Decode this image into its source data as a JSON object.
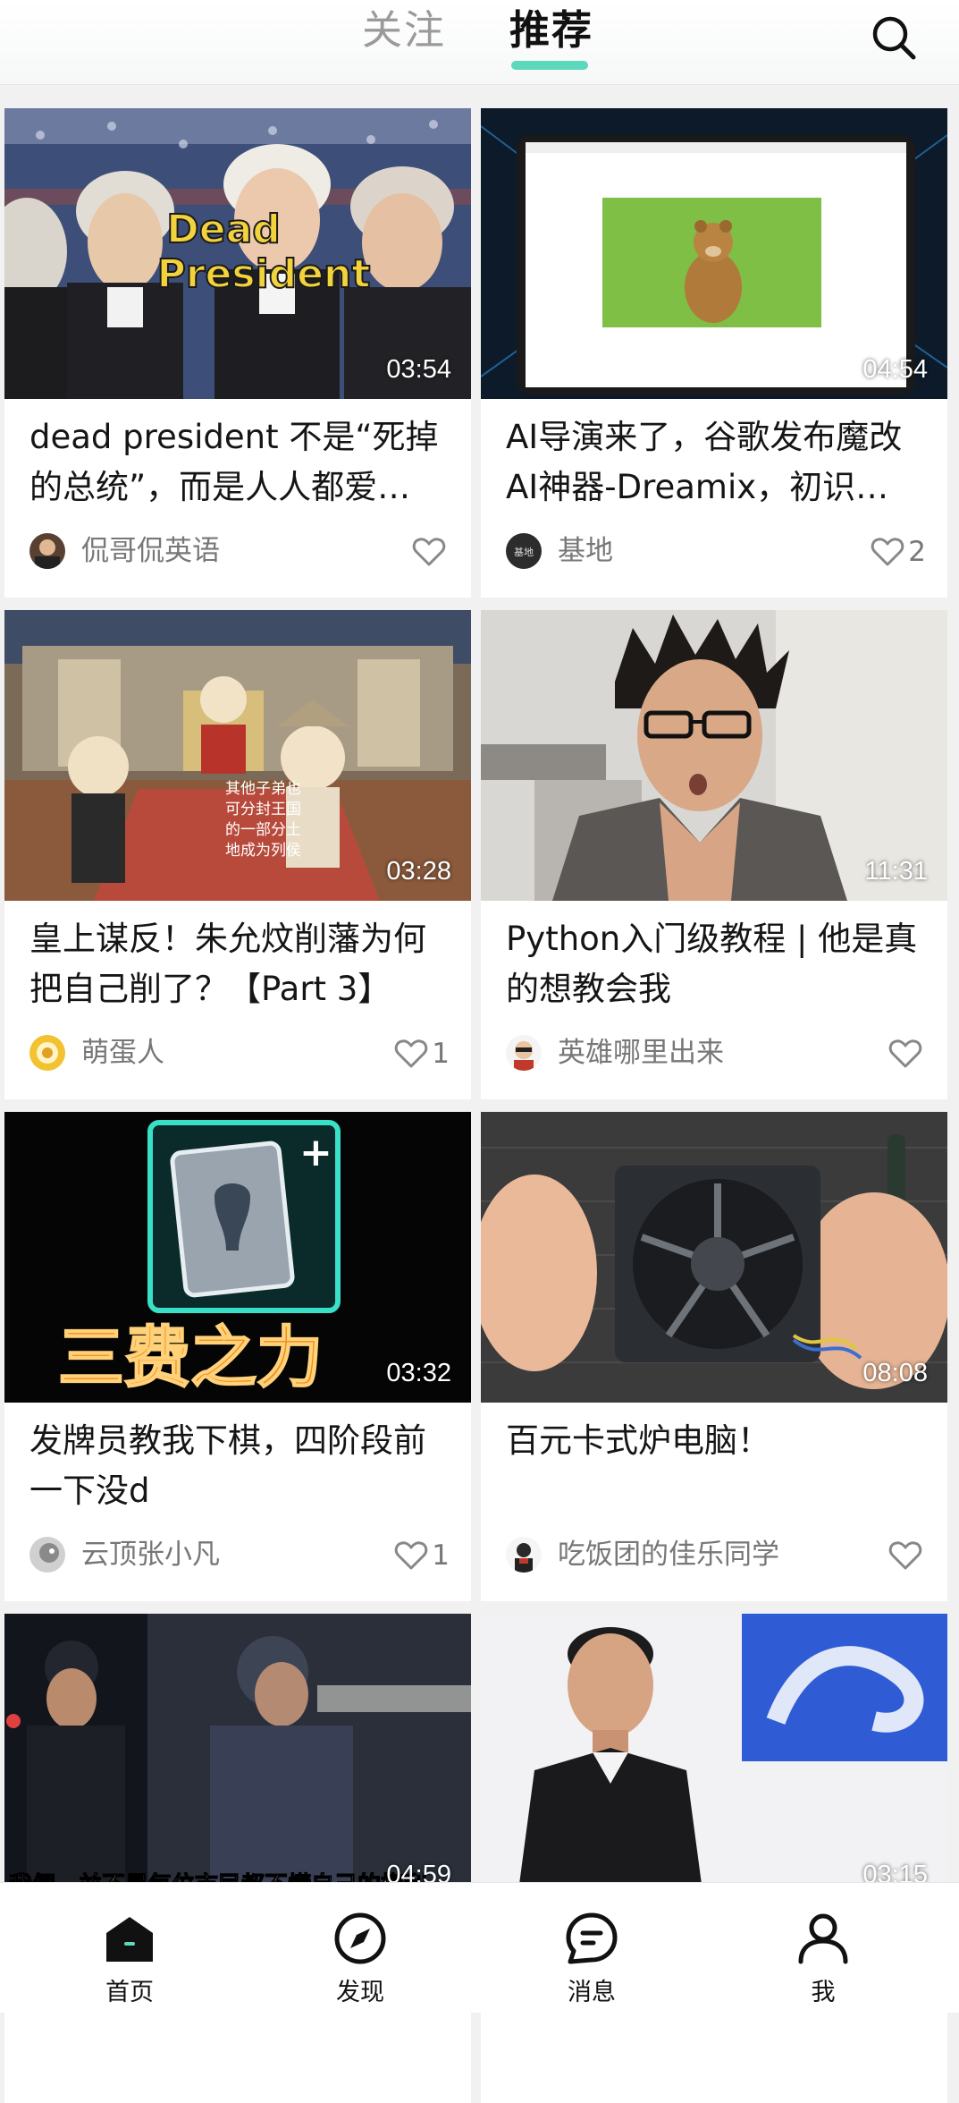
{
  "header": {
    "tabs": [
      {
        "label": "关注",
        "active": false
      },
      {
        "label": "推荐",
        "active": true
      }
    ],
    "search_icon": "search-icon",
    "accent_color": "#5dd8bb"
  },
  "feed": [
    {
      "title": "dead president 不是“死掉的总统”，而是人人都爱…",
      "duration": "03:54",
      "author": "侃哥侃英语",
      "likes": "",
      "thumbnail_text": "Dead President"
    },
    {
      "title": "AI导演来了，谷歌发布魔改AI神器-Dreamix，初识…",
      "duration": "04:54",
      "author": "基地",
      "likes": "2",
      "avatar_text": "基地"
    },
    {
      "title": "皇上谋反！朱允炆削藩为何把自己削了？【Part 3】",
      "duration": "03:28",
      "author": "萌蛋人",
      "likes": "1",
      "thumbnail_text": "其他子弟也 可分封王国 的一部分土 地成为列侯"
    },
    {
      "title": "Python入门级教程 | 他是真的想教会我",
      "duration": "11:31",
      "author": "英雄哪里出来",
      "likes": ""
    },
    {
      "title": "发牌员教我下棋，四阶段前一下没d",
      "duration": "03:32",
      "author": "云顶张小凡",
      "likes": "1",
      "thumbnail_text": "三费之力"
    },
    {
      "title": "百元卡式炉电脑！",
      "duration": "08:08",
      "author": "吃饭团的佳乐同学",
      "likes": ""
    },
    {
      "title": "",
      "duration": "04:59",
      "author": "",
      "likes": "",
      "thumbnail_text": "我們，並不是每位市民都不懂自己的權利"
    },
    {
      "title": "",
      "duration": "03:15",
      "author": "",
      "likes": ""
    }
  ],
  "bottom_nav": [
    {
      "label": "首页",
      "icon": "home-icon",
      "active": true
    },
    {
      "label": "发现",
      "icon": "compass-icon",
      "active": false
    },
    {
      "label": "消息",
      "icon": "message-icon",
      "active": false
    },
    {
      "label": "我",
      "icon": "user-icon",
      "active": false
    }
  ]
}
